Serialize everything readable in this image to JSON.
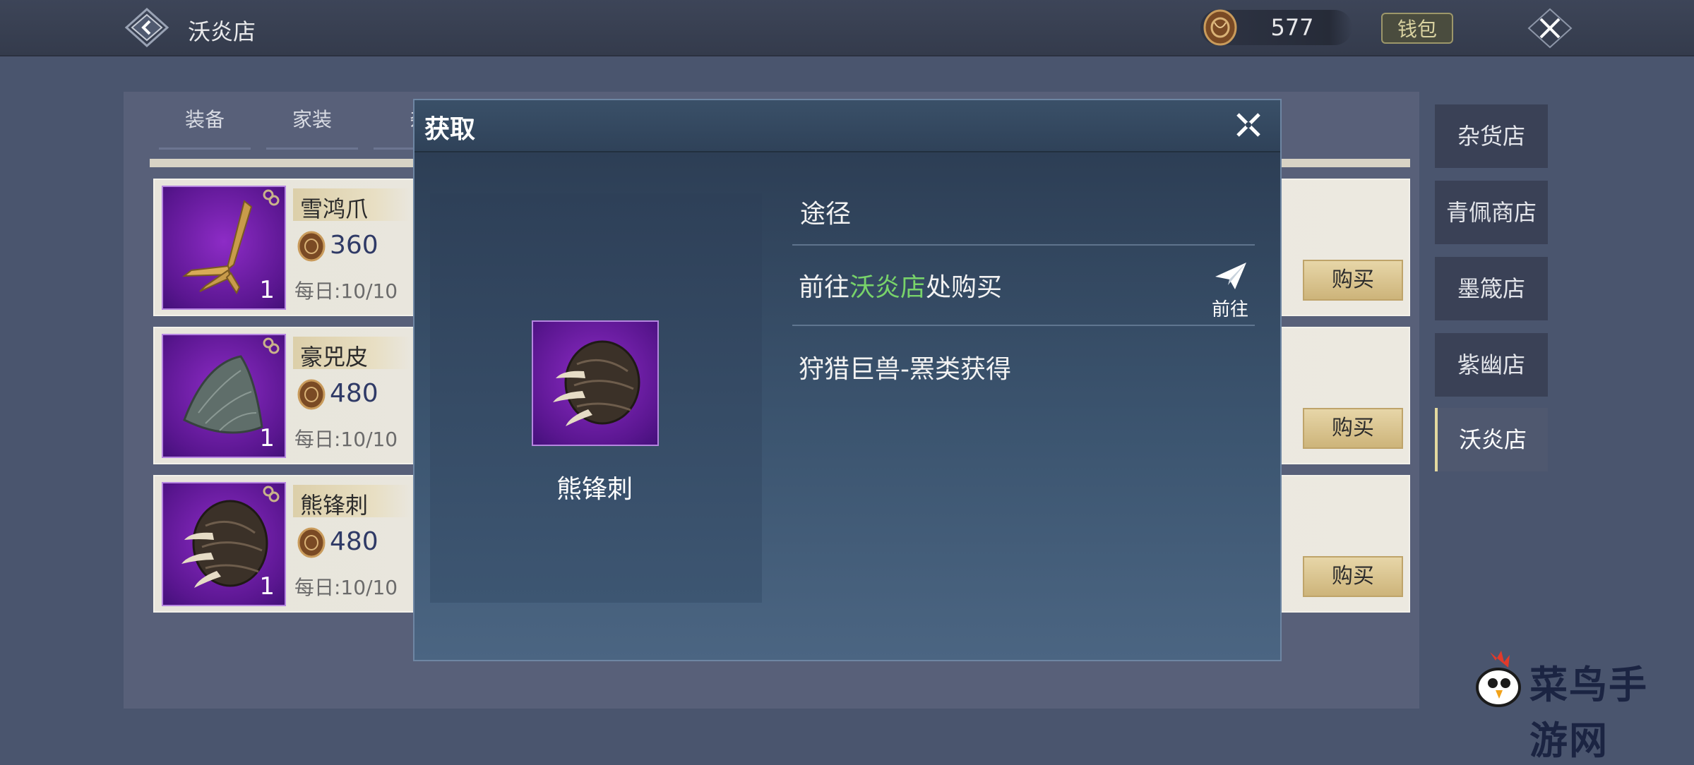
{
  "header": {
    "title": "沃炎店",
    "currency_amount": "577",
    "wallet_label": "钱包"
  },
  "tabs": [
    {
      "label": "装备"
    },
    {
      "label": "家装"
    },
    {
      "label": "杂"
    }
  ],
  "items": [
    {
      "name": "雪鸿爪",
      "price": "360",
      "daily": "每日:10/10",
      "qty": "1",
      "buy_label": "购买"
    },
    {
      "name": "豪兕皮",
      "price": "480",
      "daily": "每日:10/10",
      "qty": "1",
      "buy_label": "购买"
    },
    {
      "name": "熊锋刺",
      "price": "480",
      "daily": "每日:10/10",
      "qty": "1",
      "buy_label": "购买"
    }
  ],
  "side_shops": [
    {
      "label": "杂货店"
    },
    {
      "label": "青佩商店"
    },
    {
      "label": "墨箴店"
    },
    {
      "label": "紫幽店"
    },
    {
      "label": "沃炎店",
      "active": true
    }
  ],
  "modal": {
    "title": "获取",
    "item_name": "熊锋刺",
    "routes_header": "途径",
    "route1_prefix": "前往",
    "route1_shop": "沃炎店",
    "route1_suffix": "处购买",
    "goto_label": "前往",
    "route2": "狩猎巨兽-罴类获得"
  },
  "watermark": {
    "text": "菜鸟手游网"
  }
}
